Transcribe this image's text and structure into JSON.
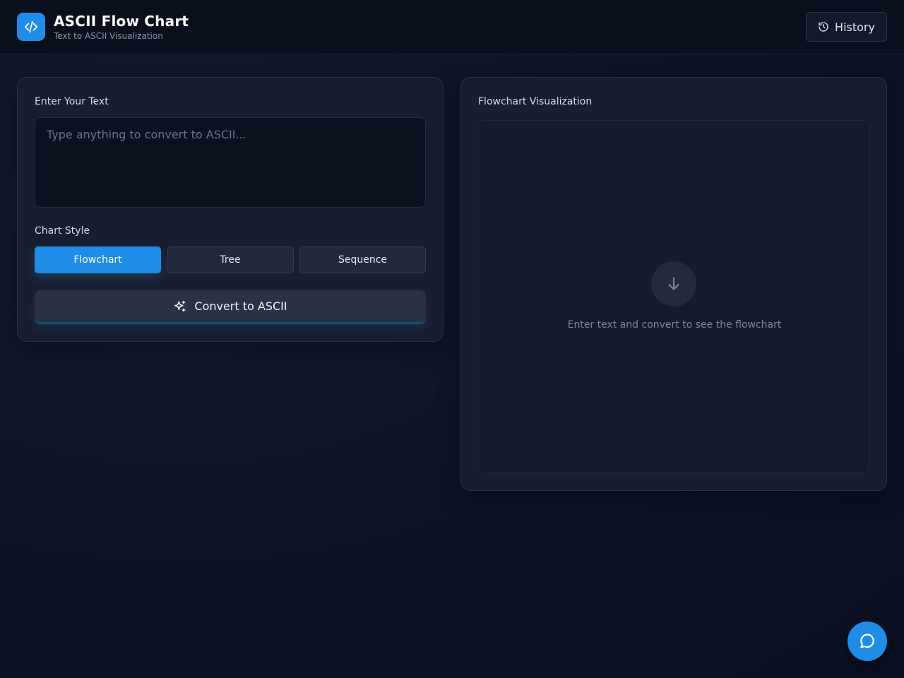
{
  "header": {
    "title": "ASCII Flow Chart",
    "subtitle": "Text to ASCII Visualization",
    "history_label": "History",
    "logo_icon": "code-icon",
    "history_icon": "history-icon"
  },
  "input_panel": {
    "label": "Enter Your Text",
    "textarea_value": "",
    "textarea_placeholder": "Type anything to convert to ASCII...",
    "style_label": "Chart Style",
    "styles": [
      {
        "label": "Flowchart",
        "selected": true
      },
      {
        "label": "Tree",
        "selected": false
      },
      {
        "label": "Sequence",
        "selected": false
      }
    ],
    "convert_label": "Convert to ASCII",
    "convert_icon": "sparkles-icon"
  },
  "output_panel": {
    "label": "Flowchart Visualization",
    "empty_message": "Enter text and convert to see the flowchart",
    "empty_icon": "arrow-down-icon"
  },
  "chat": {
    "icon": "chat-icon"
  },
  "colors": {
    "accent": "#1f8ce6",
    "background": "#0d1324",
    "panel": "#181e2f"
  }
}
